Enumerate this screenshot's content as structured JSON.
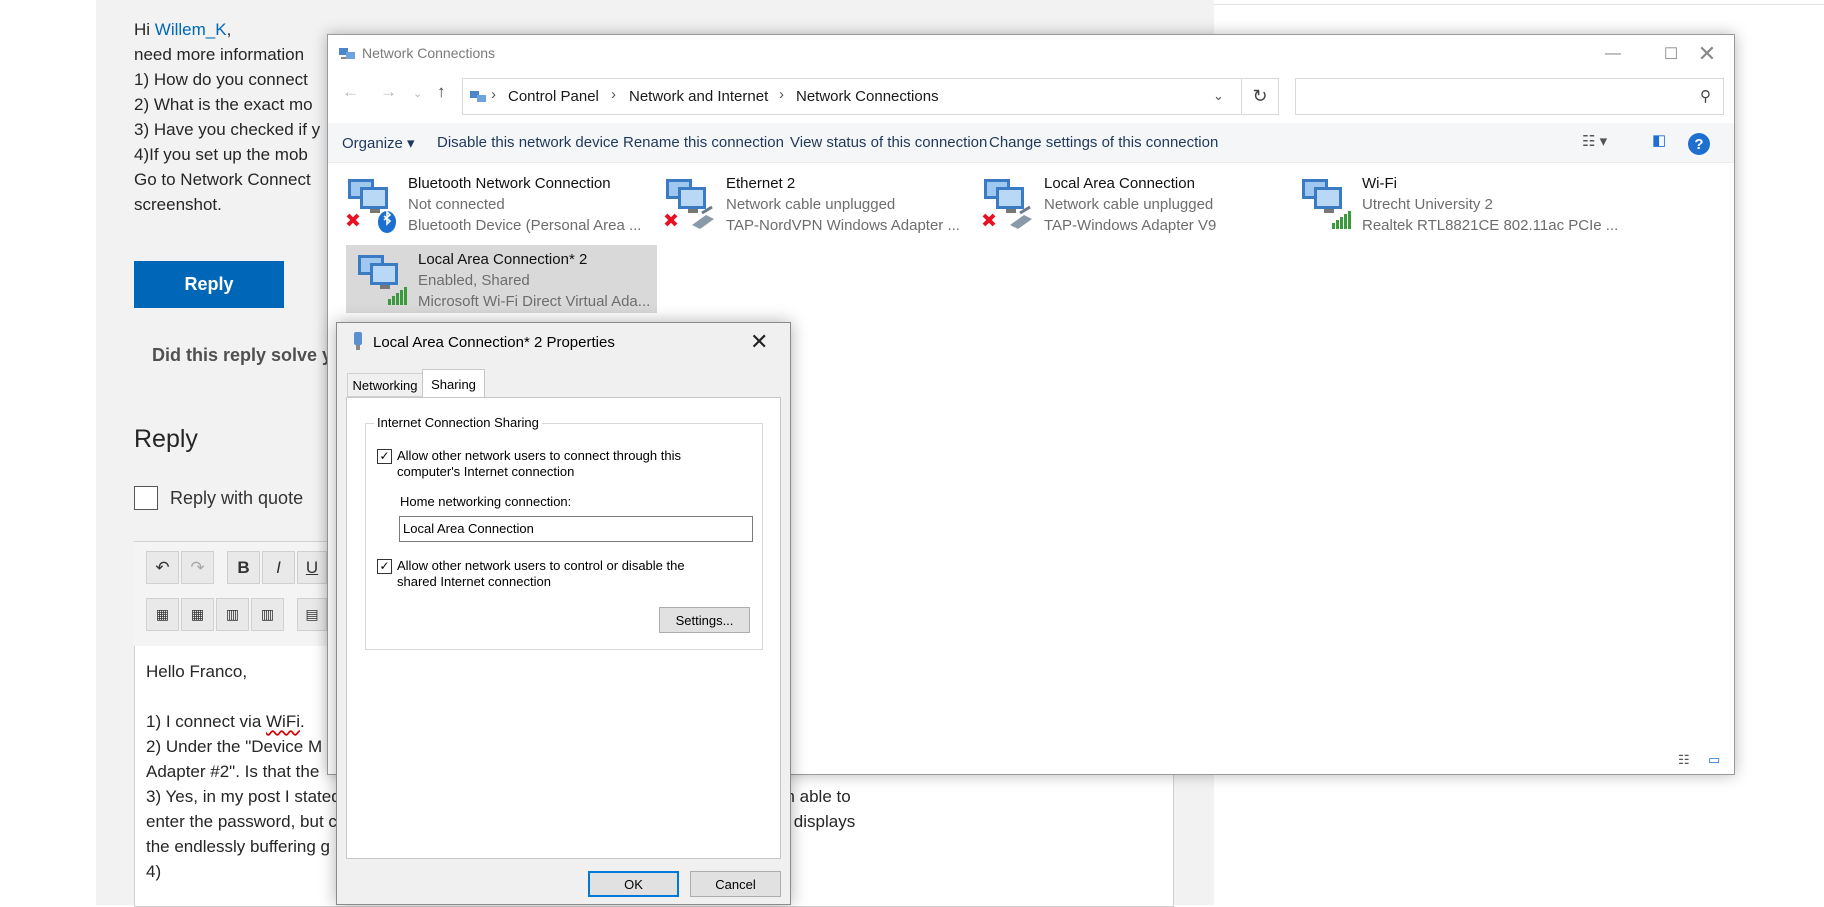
{
  "forum": {
    "greeting_hi": "Hi ",
    "greeting_user": "Willem_K",
    "greeting_comma": ",",
    "line_need": "need more information",
    "line_q1": "1) How do you connect",
    "line_q2": "2) What is the exact mo",
    "line_q3": "3) Have you checked if y",
    "line_q4": "4)If you set up the mob",
    "line_goto": "Go to Network Connect",
    "line_screenshot": "screenshot.",
    "reply_button": "Reply",
    "did_reply_solve": "Did this reply solve y",
    "reply_heading": "Reply",
    "reply_with_quote": "Reply with quote",
    "editor_bold": "B",
    "editor_italic": "I",
    "editor_underline": "U",
    "editor_lines": {
      "l1": "Hello Franco,",
      "l2a": "1) I connect via ",
      "l2b": "WiFi",
      "l2c": ".",
      "l3": "2) Under the \"Device M",
      "l4": "Adapter #2\". Is that the",
      "l5a": "3) Yes, in my post I stated",
      "l5b": "iPhone with the latest iOS, and I am able to",
      "l6a": "enter the password, but c",
      "l6b": "to indicate that you're connected, it displays",
      "l7": "the endlessly buffering g",
      "l8": "4)"
    }
  },
  "explorer": {
    "title": "Network Connections",
    "breadcrumb": [
      "Control Panel",
      "Network and Internet",
      "Network Connections"
    ],
    "search_placeholder": "",
    "commands": {
      "organize": "Organize ▾",
      "disable": "Disable this network device",
      "rename": "Rename this connection",
      "view_status": "View status of this connection",
      "change_settings": "Change settings of this connection"
    },
    "connections": [
      {
        "name": "Bluetooth Network Connection",
        "status": "Not connected",
        "device": "Bluetooth Device (Personal Area ...",
        "icon": "bluetooth-adapter-icon"
      },
      {
        "name": "Ethernet 2",
        "status": "Network cable unplugged",
        "device": "TAP-NordVPN Windows Adapter ...",
        "icon": "ethernet-adapter-icon"
      },
      {
        "name": "Local Area Connection",
        "status": "Network cable unplugged",
        "device": "TAP-Windows Adapter V9",
        "icon": "ethernet-adapter-icon"
      },
      {
        "name": "Wi-Fi",
        "status": "Utrecht University 2",
        "device": "Realtek RTL8821CE 802.11ac PCIe ...",
        "icon": "wifi-adapter-icon"
      },
      {
        "name": "Local Area Connection* 2",
        "status": "Enabled, Shared",
        "device": "Microsoft Wi-Fi Direct Virtual Ada...",
        "icon": "wifi-adapter-icon",
        "selected": true
      }
    ]
  },
  "dialog": {
    "title": "Local Area Connection* 2 Properties",
    "tabs": [
      "Networking",
      "Sharing"
    ],
    "active_tab": "Sharing",
    "group_label": "Internet Connection Sharing",
    "allow_connect_line1": "Allow other network users to connect through this",
    "allow_connect_line2": "computer's Internet connection",
    "allow_connect_checked": true,
    "home_label": "Home networking connection:",
    "home_value": "Local Area Connection",
    "allow_control_line1": "Allow other network users to control or disable the",
    "allow_control_line2": "shared Internet connection",
    "allow_control_checked": true,
    "settings_button": "Settings...",
    "ok_button": "OK",
    "cancel_button": "Cancel"
  },
  "colors": {
    "accent": "#0067b8",
    "error_x": "#e81123",
    "signal_green": "#3c9a3c",
    "help_blue": "#1f6fd0"
  }
}
